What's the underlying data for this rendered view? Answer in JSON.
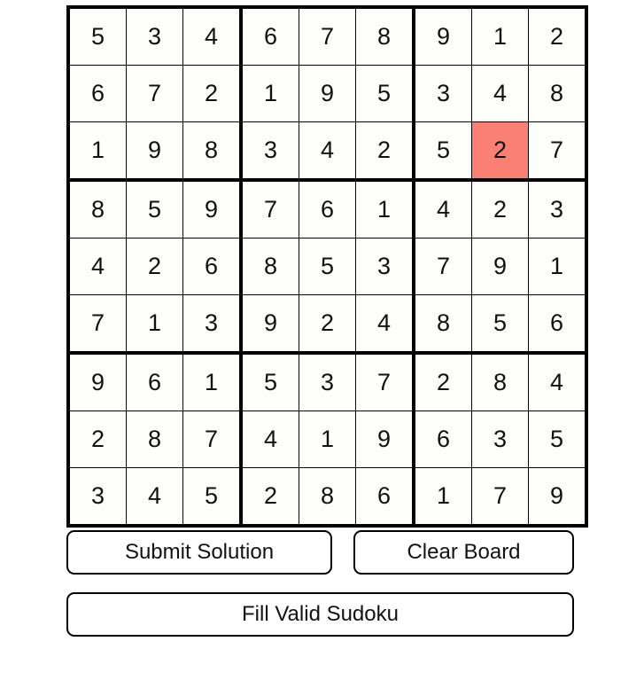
{
  "board": {
    "name": "sudoku-grid",
    "rows": 9,
    "cols": 9,
    "highlight_color": "#f98072",
    "cell_background": "#fdfdfa",
    "grid_line_color": "#000000",
    "highlighted_cell": {
      "row": 3,
      "col": 8,
      "value": "2"
    },
    "cells": [
      [
        "5",
        "3",
        "4",
        "6",
        "7",
        "8",
        "9",
        "1",
        "2"
      ],
      [
        "6",
        "7",
        "2",
        "1",
        "9",
        "5",
        "3",
        "4",
        "8"
      ],
      [
        "1",
        "9",
        "8",
        "3",
        "4",
        "2",
        "5",
        "2",
        "7"
      ],
      [
        "8",
        "5",
        "9",
        "7",
        "6",
        "1",
        "4",
        "2",
        "3"
      ],
      [
        "4",
        "2",
        "6",
        "8",
        "5",
        "3",
        "7",
        "9",
        "1"
      ],
      [
        "7",
        "1",
        "3",
        "9",
        "2",
        "4",
        "8",
        "5",
        "6"
      ],
      [
        "9",
        "6",
        "1",
        "5",
        "3",
        "7",
        "2",
        "8",
        "4"
      ],
      [
        "2",
        "8",
        "7",
        "4",
        "1",
        "9",
        "6",
        "3",
        "5"
      ],
      [
        "3",
        "4",
        "5",
        "2",
        "8",
        "6",
        "1",
        "7",
        "9"
      ]
    ]
  },
  "controls": {
    "submit_label": "Submit Solution",
    "clear_label": "Clear Board",
    "fill_label": "Fill Valid Sudoku"
  }
}
